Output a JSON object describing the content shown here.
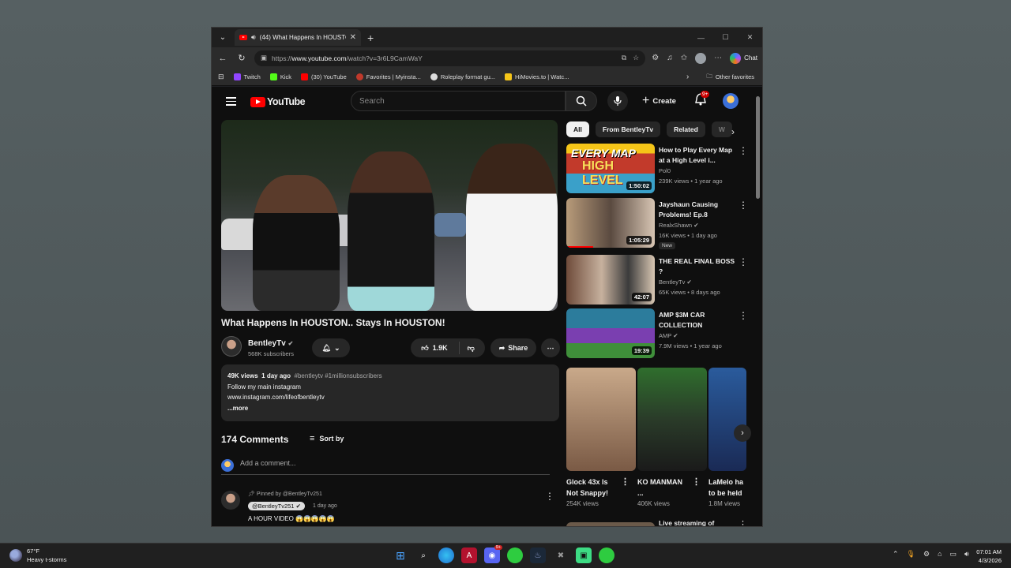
{
  "browser": {
    "tab_title": "(44) What Happens In HOUSTON.. Stays In HOUSTON!",
    "url_prefix": "https://",
    "url_host": "www.youtube.com",
    "url_path": "/watch?v=3r6L9CamWaY",
    "chat_label": "Chat",
    "favorites": [
      "Twitch",
      "Kick",
      "(30) YouTube",
      "Favorites | Myinsta...",
      "Roleplay format gu...",
      "HiMovies.to | Watc..."
    ],
    "other_favorites": "Other favorites"
  },
  "youtube": {
    "logo_text": "YouTube",
    "search_placeholder": "Search",
    "create_label": "Create",
    "notifications_badge": "9+",
    "video_title": "What Happens In HOUSTON.. Stays In HOUSTON!",
    "channel_name": "BentleyTv",
    "subscribers": "568K subscribers",
    "like_count": "1.9K",
    "share_label": "Share",
    "description": {
      "views": "49K views",
      "age": "1 day ago",
      "tags": "#bentleytv #1millionsubscribers",
      "line1": "Follow my main instagram",
      "line2": "www.instagram.com/lifeofbentleytv",
      "more": "...more"
    },
    "comments_count": "174 Comments",
    "sort_by": "Sort by",
    "add_comment_placeholder": "Add a comment...",
    "pinned_comment": {
      "pinned_by": "Pinned by @BentleyTv251",
      "handle": "@BentleyTv251",
      "age": "1 day ago",
      "text": "A HOUR VIDEO 😱😱😱😱😱"
    }
  },
  "chips": [
    "All",
    "From BentleyTv",
    "Related",
    "W"
  ],
  "recommendations": [
    {
      "title": "How to Play Every Map at a High Level i...",
      "channel": "Pol0",
      "meta": "239K views • 1 year ago",
      "duration": "1:50:02",
      "thumb_text": "EVERY MAP",
      "thumb_text2": "HIGH LEVEL"
    },
    {
      "title": "Jayshaun Causing Problems! Ep.8",
      "channel": "RealxShawn",
      "meta": "16K views • 1 day ago",
      "duration": "1:05:29",
      "badge": "New"
    },
    {
      "title": "THE REAL FINAL BOSS ?",
      "channel": "BentleyTv",
      "meta": "65K views • 8 days ago",
      "duration": "42:07"
    },
    {
      "title": "AMP $3M CAR COLLECTION",
      "channel": "AMP",
      "meta": "7.9M views • 1 year ago",
      "duration": "19:39"
    }
  ],
  "shorts": [
    {
      "title": "Glock 43x Is Not Snappy!",
      "views": "254K views"
    },
    {
      "title": "KO MANMAN ...",
      "views": "406K views"
    },
    {
      "title": "LaMelo ha to be held",
      "views": "1.8M views"
    }
  ],
  "live_title": "Live streaming of",
  "taskbar": {
    "temperature": "67°F",
    "weather": "Heavy t-storms",
    "time": "07:01 AM",
    "date": "4/3/2026",
    "discord_badge": "9+"
  },
  "colors": {
    "youtube_red": "#ff0000",
    "page_bg": "#0f0f0f",
    "chip_bg": "#272727"
  }
}
